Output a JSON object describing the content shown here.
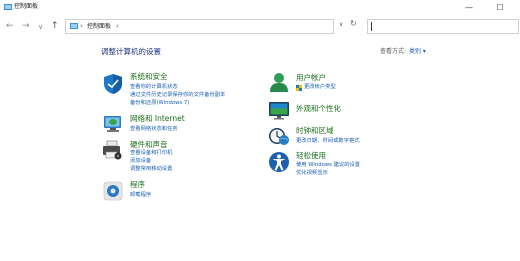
{
  "window": {
    "title": "控制面板",
    "buttons": {
      "minimize": "—",
      "maximize": "☐"
    }
  },
  "address": {
    "path": "控制面板",
    "separator": "›",
    "search_value": ""
  },
  "content": {
    "heading": "调整计算机的设置",
    "view_by_label": "查看方式:",
    "view_by_value": "类别 ▾"
  },
  "categories": {
    "security": {
      "title": "系统和安全",
      "links": [
        "查看你的计算机状态",
        "通过文件历史记录保存你的文件备份副本",
        "备份和还原(Windows 7)"
      ]
    },
    "network": {
      "title": "网络和 Internet",
      "links": [
        "查看网络状态和任务"
      ]
    },
    "hardware": {
      "title": "硬件和声音",
      "links": [
        "查看设备和打印机",
        "添加设备",
        "调整常用移动设置"
      ]
    },
    "programs": {
      "title": "程序",
      "links": [
        "卸载程序"
      ]
    },
    "users": {
      "title": "用户帐户",
      "links": [
        "更改帐户类型"
      ]
    },
    "appearance": {
      "title": "外观和个性化",
      "links": []
    },
    "clock": {
      "title": "时钟和区域",
      "links": [
        "更改日期、时间或数字格式"
      ]
    },
    "access": {
      "title": "轻松使用",
      "links": [
        "使用 Windows 建议的设置",
        "优化视频显示"
      ]
    }
  }
}
